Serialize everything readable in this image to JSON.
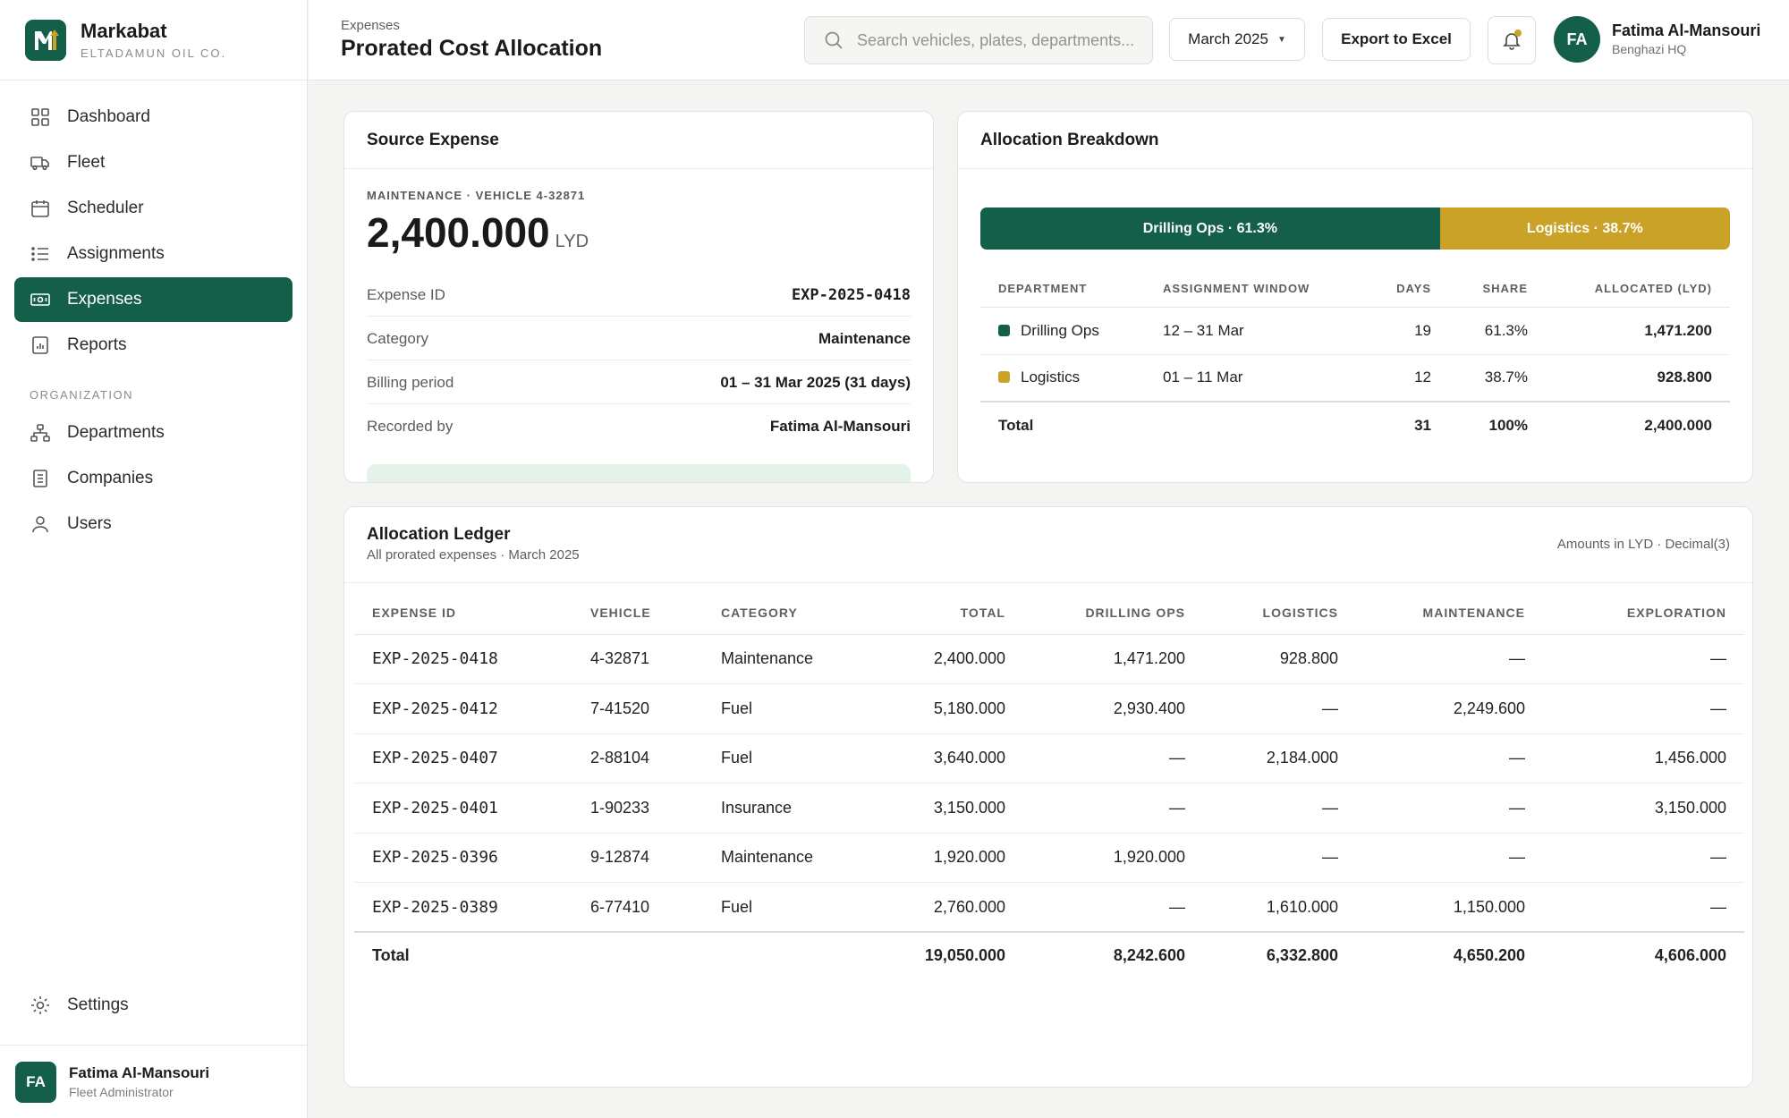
{
  "brand": {
    "name": "Markabat",
    "subtitle": "ELTADAMUN OIL CO."
  },
  "nav": {
    "items": [
      {
        "label": "Dashboard",
        "icon": "grid-icon"
      },
      {
        "label": "Fleet",
        "icon": "truck-icon"
      },
      {
        "label": "Scheduler",
        "icon": "calendar-icon"
      },
      {
        "label": "Assignments",
        "icon": "list-icon"
      },
      {
        "label": "Expenses",
        "icon": "banknote-icon",
        "active": true
      },
      {
        "label": "Reports",
        "icon": "chart-doc-icon"
      }
    ],
    "section_label": "ORGANIZATION",
    "org_items": [
      {
        "label": "Departments",
        "icon": "org-chart-icon"
      },
      {
        "label": "Companies",
        "icon": "building-doc-icon"
      },
      {
        "label": "Users",
        "icon": "user-icon"
      }
    ],
    "settings_label": "Settings"
  },
  "sidebar_user": {
    "initials": "FA",
    "name": "Fatima Al-Mansouri",
    "role": "Fleet Administrator"
  },
  "header": {
    "breadcrumb": "Expenses",
    "title": "Prorated Cost Allocation",
    "search_placeholder": "Search vehicles, plates, departments...",
    "month": "March 2025",
    "export_label": "Export to Excel",
    "user_initials": "FA",
    "user_name": "Fatima Al-Mansouri",
    "user_location": "Benghazi HQ"
  },
  "colors": {
    "primary": "#135f4a",
    "accent": "#c9a227"
  },
  "source": {
    "title": "Source Expense",
    "kicker": "MAINTENANCE · VEHICLE 4-32871",
    "amount": "2,400.000",
    "currency": "LYD",
    "fields": [
      {
        "key": "Expense ID",
        "value": "EXP-2025-0418"
      },
      {
        "key": "Category",
        "value": "Maintenance"
      },
      {
        "key": "Billing period",
        "value": "01 – 31 Mar 2025 (31 days)"
      },
      {
        "key": "Recorded by",
        "value": "Fatima Al-Mansouri"
      }
    ]
  },
  "allocation": {
    "title": "Allocation Breakdown",
    "segments": [
      {
        "label": "Drilling Ops · 61.3%",
        "share": 61.3,
        "color": "#135f4a"
      },
      {
        "label": "Logistics · 38.7%",
        "share": 38.7,
        "color": "#c9a227"
      }
    ],
    "columns": [
      "DEPARTMENT",
      "ASSIGNMENT WINDOW",
      "DAYS",
      "SHARE",
      "ALLOCATED (LYD)"
    ],
    "rows": [
      {
        "department": "Drilling Ops",
        "window": "12 – 31 Mar",
        "days": "19",
        "share": "61.3%",
        "allocated": "1,471.200",
        "color": "#135f4a"
      },
      {
        "department": "Logistics",
        "window": "01 – 11 Mar",
        "days": "12",
        "share": "38.7%",
        "allocated": "928.800",
        "color": "#c9a227"
      }
    ],
    "total": {
      "label": "Total",
      "days": "31",
      "share": "100%",
      "allocated": "2,400.000"
    }
  },
  "ledger": {
    "title": "Allocation Ledger",
    "subtitle": "All prorated expenses · March 2025",
    "note": "Amounts in LYD · Decimal(3)",
    "columns": [
      "EXPENSE ID",
      "VEHICLE",
      "CATEGORY",
      "TOTAL",
      "DRILLING OPS",
      "LOGISTICS",
      "MAINTENANCE",
      "EXPLORATION"
    ],
    "rows": [
      [
        "EXP-2025-0418",
        "4-32871",
        "Maintenance",
        "2,400.000",
        "1,471.200",
        "928.800",
        "—",
        "—"
      ],
      [
        "EXP-2025-0412",
        "7-41520",
        "Fuel",
        "5,180.000",
        "2,930.400",
        "—",
        "2,249.600",
        "—"
      ],
      [
        "EXP-2025-0407",
        "2-88104",
        "Fuel",
        "3,640.000",
        "—",
        "2,184.000",
        "—",
        "1,456.000"
      ],
      [
        "EXP-2025-0401",
        "1-90233",
        "Insurance",
        "3,150.000",
        "—",
        "—",
        "—",
        "3,150.000"
      ],
      [
        "EXP-2025-0396",
        "9-12874",
        "Maintenance",
        "1,920.000",
        "1,920.000",
        "—",
        "—",
        "—"
      ],
      [
        "EXP-2025-0389",
        "6-77410",
        "Fuel",
        "2,760.000",
        "—",
        "1,610.000",
        "1,150.000",
        "—"
      ]
    ],
    "total": [
      "Total",
      "",
      "",
      "19,050.000",
      "8,242.600",
      "6,332.800",
      "4,650.200",
      "4,606.000"
    ]
  }
}
